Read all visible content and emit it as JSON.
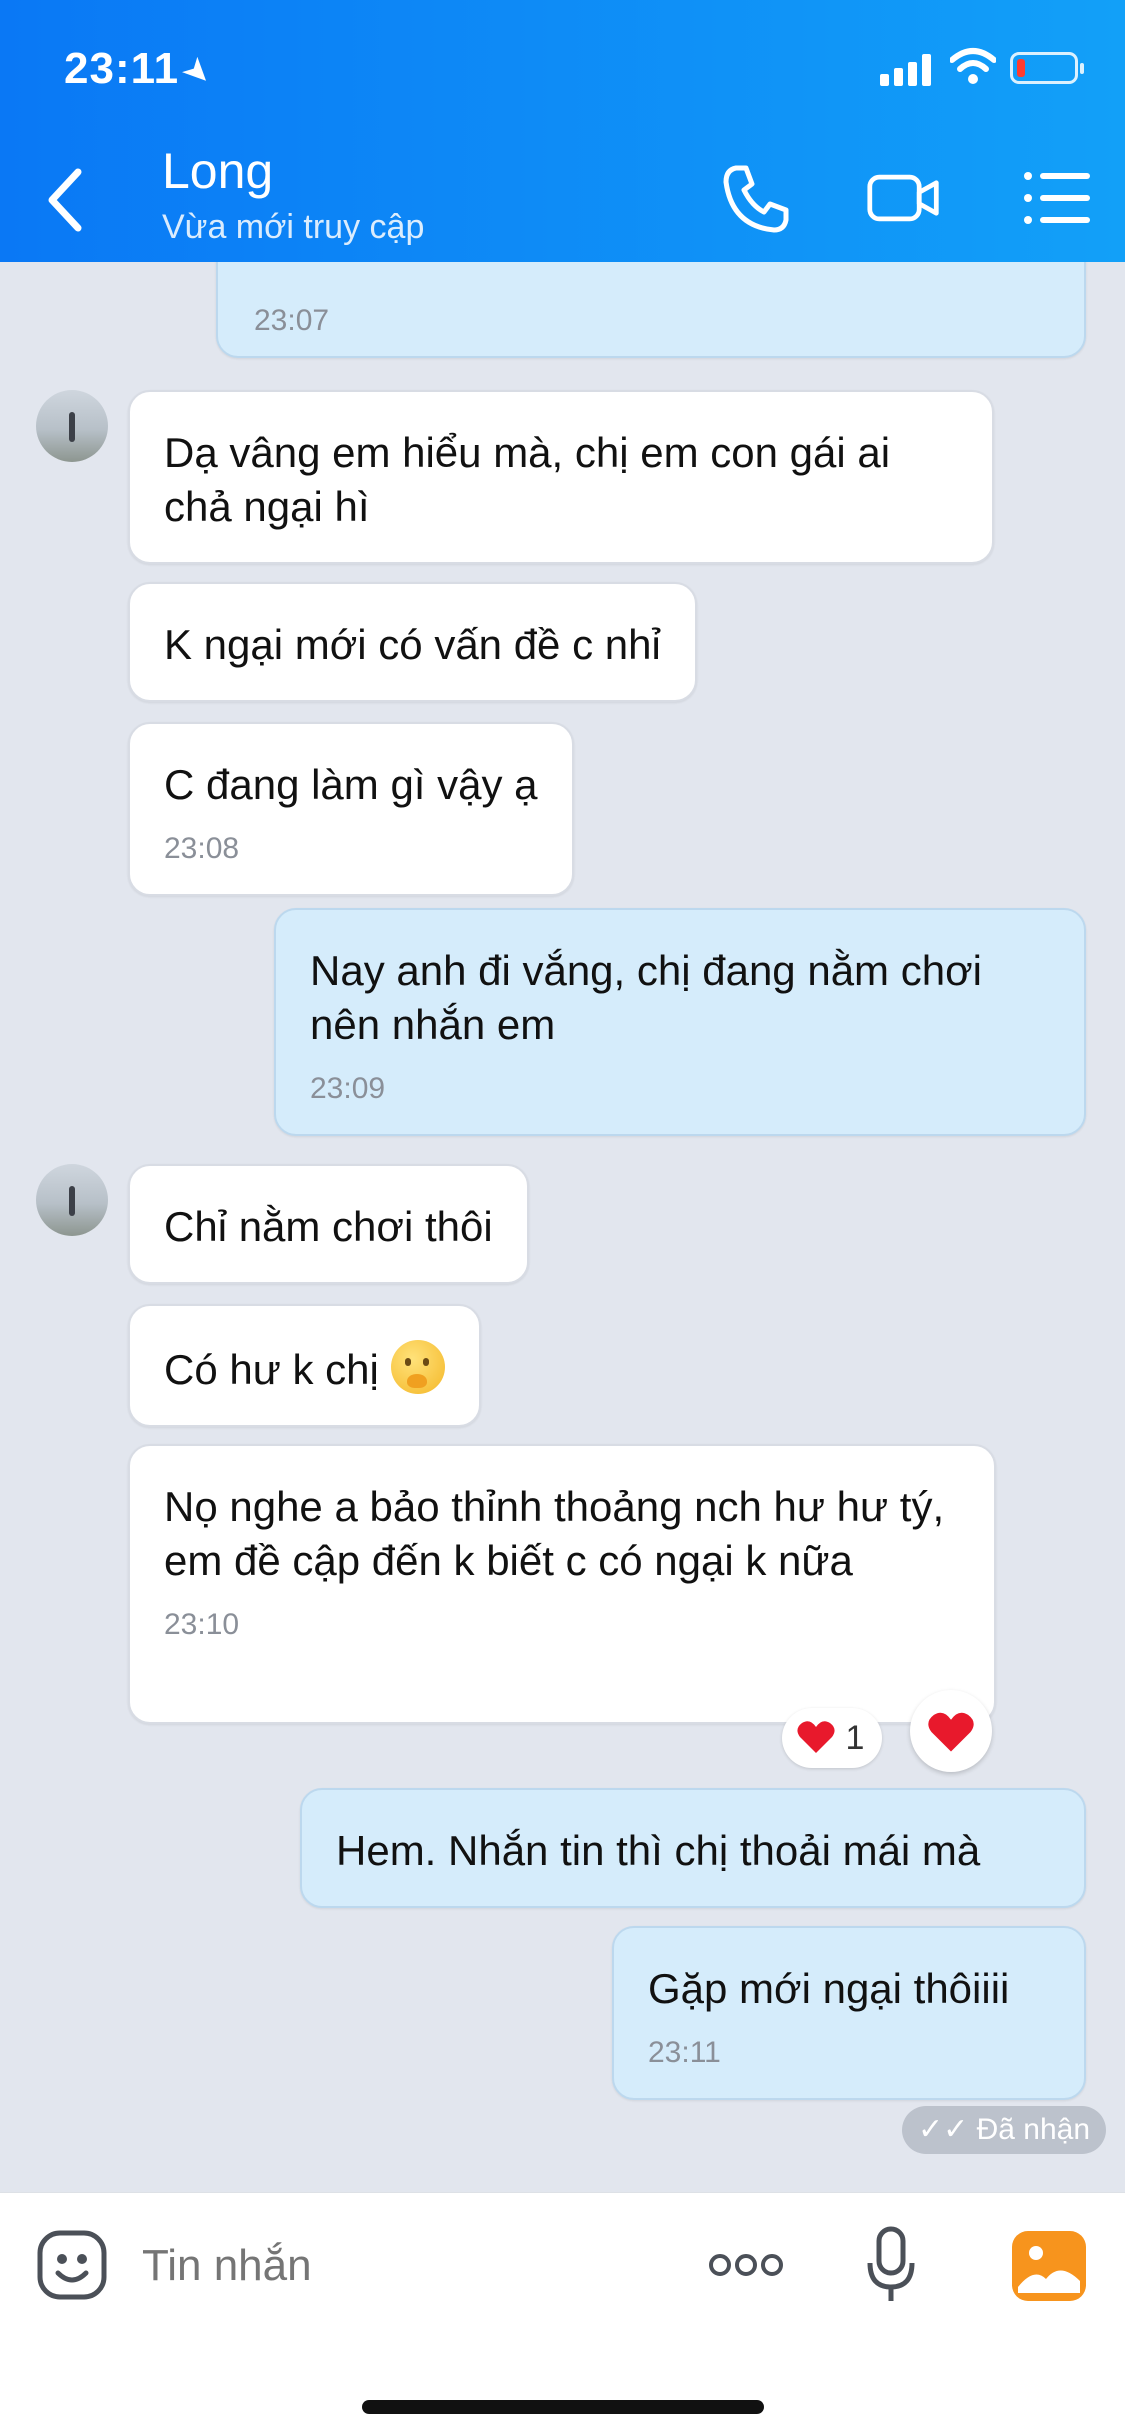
{
  "status_bar": {
    "time": "23:11"
  },
  "header": {
    "contact_name": "Long",
    "contact_status": "Vừa mới truy cập",
    "icons": [
      "back-chevron-icon",
      "phone-icon",
      "video-camera-icon",
      "menu-list-icon"
    ]
  },
  "messages": [
    {
      "dir": "out",
      "text": "",
      "time": "23:07"
    },
    {
      "dir": "in",
      "text": "Dạ vâng em hiểu mà, chị em con gái ai chả ngại hì"
    },
    {
      "dir": "in",
      "text": "K ngại mới có vấn đề c nhỉ"
    },
    {
      "dir": "in",
      "text": "C đang làm gì vậy ạ",
      "time": "23:08"
    },
    {
      "dir": "out",
      "text": "Nay anh đi vắng, chị đang nằm chơi nên nhắn em",
      "time": "23:09"
    },
    {
      "dir": "in",
      "text": "Chỉ nằm chơi thôi"
    },
    {
      "dir": "in",
      "text": "Có hư k chị"
    },
    {
      "dir": "in",
      "text": "Nọ nghe a bảo thỉnh thoảng nch hư hư tý, em đề cập đến k biết c có ngại k nữa",
      "time": "23:10"
    },
    {
      "dir": "out",
      "text": "Hem. Nhắn tin thì chị thoải mái mà"
    },
    {
      "dir": "out",
      "text": "Gặp mới ngại thôiiii",
      "time": "23:11"
    }
  ],
  "reaction": {
    "count": "1",
    "accent": "#e8192c"
  },
  "seen_status": "Đã nhận",
  "input_bar": {
    "placeholder": "Tin nhắn",
    "icons": [
      "sticker-icon",
      "more-dots-icon",
      "microphone-icon",
      "photo-icon"
    ]
  },
  "colors": {
    "header_start": "#0a78f5",
    "header_end": "#12a0f8",
    "background": "#e2e6ee",
    "incoming_bubble": "#ffffff",
    "outgoing_bubble": "#d5ecfb",
    "photo_icon": "#f7941d"
  }
}
